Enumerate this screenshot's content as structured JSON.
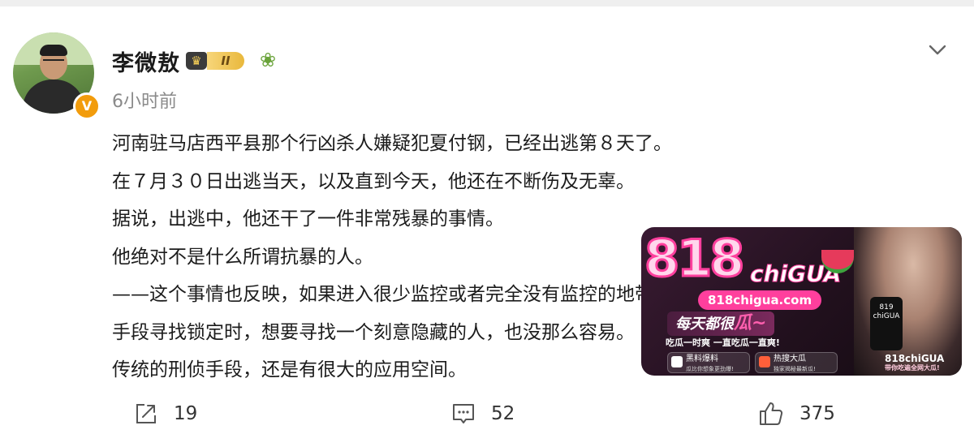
{
  "post": {
    "author": {
      "name": "李微敖",
      "vip_level": "II",
      "verified_mark": "V"
    },
    "time": "6小时前",
    "content": [
      "河南驻马店西平县那个行凶杀人嫌疑犯夏付钢，已经出逃第８天了。",
      "在７月３０日出逃当天，以及直到今天，他还在不断伤及无辜。",
      "据说，出逃中，他还干了一件非常残暴的事情。",
      "他绝对不是什么所谓抗暴的人。",
      "——这个事情也反映，如果进入很少监控或者完全没有监控的地带，无法通过技术",
      "手段寻找锁定时，想要寻找一个刻意隐藏的人，也没那么容易。",
      "传统的刑侦手段，还是有很大的应用空间。"
    ],
    "actions": {
      "shares": "19",
      "comments": "52",
      "likes": "375"
    }
  },
  "ad": {
    "logo_number": "818",
    "logo_word": "chiGUA",
    "domain": "818chigua.com",
    "slogan_prefix": "每天都很",
    "slogan_highlight": "瓜~",
    "subtitle": "吃瓜一时爽 一直吃瓜一直爽!",
    "cta1_title": "黑料爆料",
    "cta1_sub": "瓜比你想象更劲爆!",
    "cta2_title": "热搜大瓜",
    "cta2_sub": "独家揭秘最新瓜!",
    "phone_text": "819 chiGUA",
    "brand_title": "818chiGUA",
    "brand_sub": "带你吃遍全网大瓜!",
    "colors": {
      "accent": "#ff3f9d",
      "background": "#21101d"
    }
  }
}
